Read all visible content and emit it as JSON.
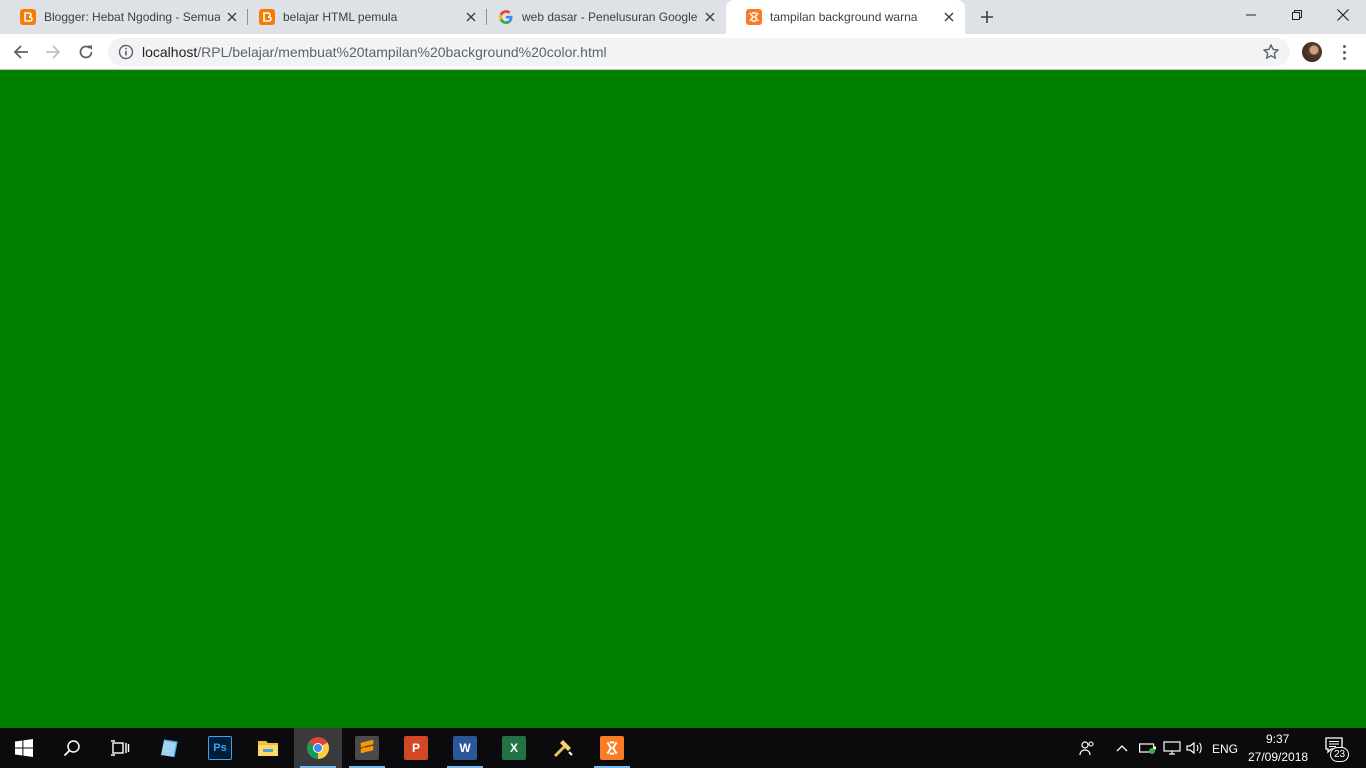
{
  "browser": {
    "tabs": [
      {
        "title": "Blogger: Hebat Ngoding - Semua",
        "icon": "blogger-icon",
        "active": false
      },
      {
        "title": "belajar HTML pemula",
        "icon": "blogger-icon",
        "active": false
      },
      {
        "title": "web dasar - Penelusuran Google",
        "icon": "google-icon",
        "active": false
      },
      {
        "title": "tampilan background warna",
        "icon": "xampp-icon",
        "active": true
      }
    ],
    "address": {
      "host": "localhost",
      "path": "/RPL/belajar/membuat%20tampilan%20background%20color.html"
    }
  },
  "page": {
    "background_color": "#008000"
  },
  "taskbar": {
    "apps": [
      {
        "name": "photos-icon"
      },
      {
        "name": "photoshop-icon",
        "label": "Ps"
      },
      {
        "name": "file-explorer-icon"
      },
      {
        "name": "chrome-icon"
      },
      {
        "name": "sublime-text-icon"
      },
      {
        "name": "powerpoint-icon",
        "label": "P"
      },
      {
        "name": "word-icon",
        "label": "W"
      },
      {
        "name": "excel-icon",
        "label": "X"
      },
      {
        "name": "tools-icon"
      },
      {
        "name": "xampp-icon"
      }
    ],
    "tray": {
      "language": "ENG",
      "time": "9:37",
      "date": "27/09/2018",
      "notification_count": "23"
    }
  }
}
